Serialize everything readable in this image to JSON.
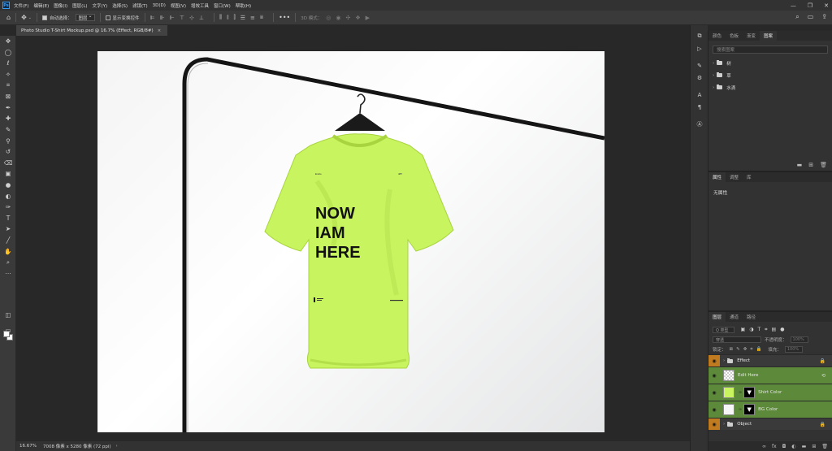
{
  "menu": {
    "logo": "Ps",
    "items": [
      "文件(F)",
      "编辑(E)",
      "图像(I)",
      "图层(L)",
      "文字(Y)",
      "选择(S)",
      "滤镜(T)",
      "3D(D)",
      "视图(V)",
      "增效工具",
      "窗口(W)",
      "帮助(H)"
    ],
    "window_controls": [
      "—",
      "❐",
      "✕"
    ]
  },
  "options": {
    "auto_select_label": "自动选择：",
    "auto_select_target": "图层",
    "transform_label": "显示变换控件",
    "mode_label": "3D 模式："
  },
  "document": {
    "tab_title": "Photo Studio T-Shirt Mockup.psd @ 16.7% (Effect, RGB/8#)",
    "close": "×"
  },
  "mockup": {
    "headline": [
      "NOW",
      "IAM",
      "HERE"
    ],
    "tag_left": "Emilo",
    "tag_right": "487",
    "shirt_color": "#c8f55f",
    "shirt_shadow": "#a8d43f"
  },
  "status": {
    "zoom": "16.67%",
    "info": "7008 像素 x 5280 像素 (72 ppi)"
  },
  "panels": {
    "top_tabs": [
      "颜色",
      "色板",
      "渐变",
      "图案"
    ],
    "top_active": 3,
    "search_placeholder": "搜索图案",
    "pattern_groups": [
      "树",
      "草",
      "水滴"
    ],
    "props_tabs": [
      "属性",
      "调整",
      "库"
    ],
    "props_active": 0,
    "props_empty": "无属性",
    "layers_tabs": [
      "图层",
      "通道",
      "路径"
    ],
    "layers_active": 0,
    "kind_filter": "Q 类型",
    "blend_mode": "穿透",
    "opacity_label": "不透明度：",
    "opacity_value": "100%",
    "lock_label": "锁定：",
    "fill_label": "填充：",
    "fill_value": "100%",
    "layers": [
      {
        "name": "Effect",
        "kind": "group",
        "tone": "orange"
      },
      {
        "name": "Edit Here",
        "kind": "smart",
        "tone": "green"
      },
      {
        "name": "Shirt Color",
        "kind": "fill-lime",
        "tone": "green"
      },
      {
        "name": "BG Color",
        "kind": "fill-white",
        "tone": "green"
      },
      {
        "name": "Object",
        "kind": "group",
        "tone": "orange"
      }
    ]
  }
}
